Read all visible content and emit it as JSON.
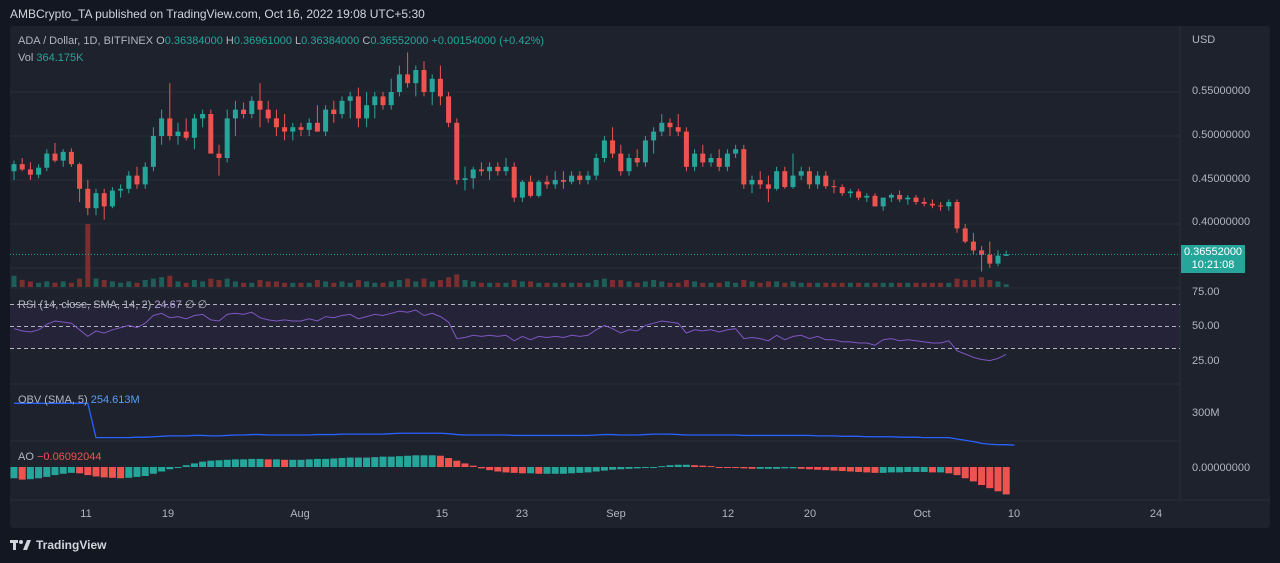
{
  "header": {
    "text": "AMBCrypto_TA published on TradingView.com, Oct 16, 2022 19:08 UTC+5:30"
  },
  "legend": {
    "symbol": "ADA / Dollar, 1D, BITFINEX",
    "o_label": "O",
    "o": "0.36384000",
    "h_label": "H",
    "h": "0.36961000",
    "l_label": "L",
    "l": "0.36384000",
    "c_label": "C",
    "c": "0.36552000",
    "change": "+0.00154000 (+0.42%)",
    "vol_label": "Vol",
    "vol": "364.175K"
  },
  "price_axis": {
    "currency": "USD",
    "ticks": [
      "0.55000000",
      "0.50000000",
      "0.45000000",
      "0.40000000"
    ],
    "last_price": "0.36552000",
    "countdown": "10:21:08"
  },
  "rsi": {
    "label": "RSI (14, close, SMA, 14, 2)",
    "value": "24.67",
    "extra": "∅ ∅",
    "ticks": [
      "75.00",
      "50.00",
      "25.00"
    ]
  },
  "obv": {
    "label": "OBV (SMA, 5)",
    "value": "254.613M",
    "tick": "300M"
  },
  "ao": {
    "label": "AO",
    "value": "−0.06092044",
    "tick": "0.00000000"
  },
  "time_axis": [
    "11",
    "19",
    "Aug",
    "15",
    "23",
    "Sep",
    "12",
    "20",
    "Oct",
    "10",
    "24"
  ],
  "brand": "TradingView",
  "colors": {
    "up": "#26a69a",
    "down": "#ef5350",
    "rsi": "#7e57c2",
    "obv": "#2962ff"
  },
  "chart_data": {
    "type": "candlestick",
    "symbol": "ADA/USD",
    "interval": "1D",
    "ohlc": [
      [
        0.46,
        0.472,
        0.45,
        0.468
      ],
      [
        0.468,
        0.475,
        0.46,
        0.462
      ],
      [
        0.462,
        0.47,
        0.45,
        0.456
      ],
      [
        0.456,
        0.468,
        0.452,
        0.464
      ],
      [
        0.464,
        0.485,
        0.46,
        0.48
      ],
      [
        0.48,
        0.492,
        0.47,
        0.472
      ],
      [
        0.472,
        0.485,
        0.465,
        0.482
      ],
      [
        0.482,
        0.486,
        0.465,
        0.468
      ],
      [
        0.468,
        0.47,
        0.425,
        0.44
      ],
      [
        0.44,
        0.45,
        0.41,
        0.418
      ],
      [
        0.418,
        0.44,
        0.41,
        0.435
      ],
      [
        0.435,
        0.44,
        0.405,
        0.42
      ],
      [
        0.42,
        0.442,
        0.418,
        0.438
      ],
      [
        0.438,
        0.445,
        0.43,
        0.44
      ],
      [
        0.44,
        0.46,
        0.435,
        0.455
      ],
      [
        0.455,
        0.465,
        0.44,
        0.445
      ],
      [
        0.445,
        0.47,
        0.44,
        0.465
      ],
      [
        0.465,
        0.51,
        0.46,
        0.5
      ],
      [
        0.5,
        0.53,
        0.49,
        0.52
      ],
      [
        0.52,
        0.56,
        0.495,
        0.5
      ],
      [
        0.5,
        0.515,
        0.49,
        0.505
      ],
      [
        0.505,
        0.52,
        0.495,
        0.498
      ],
      [
        0.498,
        0.525,
        0.485,
        0.52
      ],
      [
        0.52,
        0.53,
        0.51,
        0.525
      ],
      [
        0.525,
        0.53,
        0.48,
        0.48
      ],
      [
        0.48,
        0.49,
        0.455,
        0.475
      ],
      [
        0.475,
        0.53,
        0.47,
        0.52
      ],
      [
        0.52,
        0.54,
        0.5,
        0.53
      ],
      [
        0.53,
        0.538,
        0.52,
        0.525
      ],
      [
        0.525,
        0.545,
        0.52,
        0.54
      ],
      [
        0.54,
        0.56,
        0.51,
        0.53
      ],
      [
        0.53,
        0.54,
        0.515,
        0.52
      ],
      [
        0.52,
        0.53,
        0.5,
        0.51
      ],
      [
        0.51,
        0.525,
        0.495,
        0.505
      ],
      [
        0.505,
        0.515,
        0.495,
        0.51
      ],
      [
        0.51,
        0.515,
        0.5,
        0.507
      ],
      [
        0.507,
        0.52,
        0.5,
        0.515
      ],
      [
        0.515,
        0.535,
        0.505,
        0.505
      ],
      [
        0.505,
        0.535,
        0.5,
        0.53
      ],
      [
        0.53,
        0.54,
        0.515,
        0.525
      ],
      [
        0.525,
        0.545,
        0.52,
        0.54
      ],
      [
        0.54,
        0.55,
        0.52,
        0.545
      ],
      [
        0.545,
        0.555,
        0.51,
        0.52
      ],
      [
        0.52,
        0.55,
        0.51,
        0.535
      ],
      [
        0.535,
        0.55,
        0.52,
        0.545
      ],
      [
        0.545,
        0.55,
        0.53,
        0.535
      ],
      [
        0.535,
        0.565,
        0.53,
        0.55
      ],
      [
        0.55,
        0.58,
        0.545,
        0.57
      ],
      [
        0.57,
        0.595,
        0.555,
        0.56
      ],
      [
        0.56,
        0.58,
        0.545,
        0.575
      ],
      [
        0.575,
        0.585,
        0.545,
        0.55
      ],
      [
        0.55,
        0.57,
        0.535,
        0.565
      ],
      [
        0.565,
        0.58,
        0.535,
        0.545
      ],
      [
        0.545,
        0.55,
        0.51,
        0.515
      ],
      [
        0.515,
        0.52,
        0.445,
        0.45
      ],
      [
        0.45,
        0.465,
        0.438,
        0.452
      ],
      [
        0.452,
        0.465,
        0.44,
        0.462
      ],
      [
        0.462,
        0.47,
        0.455,
        0.46
      ],
      [
        0.46,
        0.47,
        0.45,
        0.465
      ],
      [
        0.465,
        0.47,
        0.455,
        0.46
      ],
      [
        0.46,
        0.475,
        0.455,
        0.465
      ],
      [
        0.465,
        0.47,
        0.425,
        0.43
      ],
      [
        0.43,
        0.45,
        0.425,
        0.448
      ],
      [
        0.448,
        0.455,
        0.43,
        0.432
      ],
      [
        0.432,
        0.45,
        0.43,
        0.448
      ],
      [
        0.448,
        0.455,
        0.44,
        0.445
      ],
      [
        0.445,
        0.46,
        0.44,
        0.45
      ],
      [
        0.45,
        0.46,
        0.44,
        0.448
      ],
      [
        0.448,
        0.46,
        0.445,
        0.455
      ],
      [
        0.455,
        0.46,
        0.445,
        0.45
      ],
      [
        0.45,
        0.46,
        0.445,
        0.455
      ],
      [
        0.455,
        0.48,
        0.45,
        0.475
      ],
      [
        0.475,
        0.5,
        0.47,
        0.495
      ],
      [
        0.495,
        0.51,
        0.475,
        0.48
      ],
      [
        0.48,
        0.49,
        0.455,
        0.46
      ],
      [
        0.46,
        0.48,
        0.455,
        0.475
      ],
      [
        0.475,
        0.485,
        0.465,
        0.47
      ],
      [
        0.47,
        0.5,
        0.465,
        0.495
      ],
      [
        0.495,
        0.51,
        0.48,
        0.505
      ],
      [
        0.505,
        0.525,
        0.5,
        0.515
      ],
      [
        0.515,
        0.52,
        0.5,
        0.51
      ],
      [
        0.51,
        0.525,
        0.5,
        0.505
      ],
      [
        0.505,
        0.51,
        0.46,
        0.465
      ],
      [
        0.465,
        0.485,
        0.46,
        0.48
      ],
      [
        0.48,
        0.49,
        0.465,
        0.47
      ],
      [
        0.47,
        0.48,
        0.465,
        0.475
      ],
      [
        0.475,
        0.485,
        0.46,
        0.465
      ],
      [
        0.465,
        0.485,
        0.46,
        0.48
      ],
      [
        0.48,
        0.49,
        0.475,
        0.485
      ],
      [
        0.485,
        0.49,
        0.44,
        0.445
      ],
      [
        0.445,
        0.455,
        0.435,
        0.45
      ],
      [
        0.45,
        0.46,
        0.44,
        0.445
      ],
      [
        0.445,
        0.455,
        0.425,
        0.44
      ],
      [
        0.44,
        0.465,
        0.438,
        0.46
      ],
      [
        0.46,
        0.465,
        0.44,
        0.442
      ],
      [
        0.442,
        0.48,
        0.44,
        0.455
      ],
      [
        0.455,
        0.465,
        0.45,
        0.46
      ],
      [
        0.46,
        0.465,
        0.44,
        0.445
      ],
      [
        0.445,
        0.46,
        0.44,
        0.455
      ],
      [
        0.455,
        0.46,
        0.44,
        0.443
      ],
      [
        0.443,
        0.45,
        0.435,
        0.442
      ],
      [
        0.442,
        0.445,
        0.432,
        0.435
      ],
      [
        0.435,
        0.44,
        0.43,
        0.437
      ],
      [
        0.437,
        0.44,
        0.427,
        0.43
      ],
      [
        0.43,
        0.435,
        0.425,
        0.432
      ],
      [
        0.432,
        0.435,
        0.42,
        0.42
      ],
      [
        0.42,
        0.43,
        0.415,
        0.43
      ],
      [
        0.43,
        0.435,
        0.425,
        0.433
      ],
      [
        0.433,
        0.438,
        0.425,
        0.428
      ],
      [
        0.428,
        0.433,
        0.422,
        0.43
      ],
      [
        0.43,
        0.433,
        0.422,
        0.425
      ],
      [
        0.425,
        0.43,
        0.42,
        0.423
      ],
      [
        0.423,
        0.428,
        0.418,
        0.421
      ],
      [
        0.421,
        0.425,
        0.415,
        0.42
      ],
      [
        0.42,
        0.428,
        0.415,
        0.425
      ],
      [
        0.425,
        0.428,
        0.39,
        0.395
      ],
      [
        0.395,
        0.4,
        0.378,
        0.38
      ],
      [
        0.38,
        0.39,
        0.365,
        0.37
      ],
      [
        0.37,
        0.375,
        0.346,
        0.365
      ],
      [
        0.365,
        0.38,
        0.35,
        0.355
      ],
      [
        0.355,
        0.37,
        0.352,
        0.364
      ],
      [
        0.3638,
        0.3696,
        0.3638,
        0.3655
      ]
    ],
    "volume": [
      0.8,
      0.5,
      0.4,
      0.3,
      0.4,
      0.3,
      0.4,
      0.3,
      0.6,
      4.5,
      0.6,
      0.5,
      0.4,
      0.3,
      0.4,
      0.3,
      0.5,
      0.6,
      0.7,
      0.8,
      0.4,
      0.3,
      0.5,
      0.4,
      0.6,
      0.5,
      0.6,
      0.4,
      0.3,
      0.3,
      0.5,
      0.4,
      0.4,
      0.3,
      0.3,
      0.3,
      0.3,
      0.5,
      0.4,
      0.3,
      0.4,
      0.3,
      0.5,
      0.4,
      0.3,
      0.3,
      0.4,
      0.5,
      0.6,
      0.4,
      0.6,
      0.4,
      0.5,
      0.7,
      0.9,
      0.5,
      0.4,
      0.3,
      0.3,
      0.3,
      0.3,
      0.5,
      0.4,
      0.4,
      0.3,
      0.3,
      0.3,
      0.3,
      0.3,
      0.3,
      0.3,
      0.5,
      0.6,
      0.5,
      0.5,
      0.4,
      0.3,
      0.4,
      0.5,
      0.4,
      0.3,
      0.3,
      0.5,
      0.4,
      0.3,
      0.3,
      0.3,
      0.4,
      0.3,
      0.5,
      0.4,
      0.3,
      0.4,
      0.4,
      0.3,
      0.4,
      0.3,
      0.3,
      0.3,
      0.3,
      0.3,
      0.3,
      0.3,
      0.3,
      0.3,
      0.3,
      0.3,
      0.3,
      0.3,
      0.3,
      0.3,
      0.3,
      0.3,
      0.3,
      0.3,
      0.6,
      0.5,
      0.5,
      0.7,
      0.5,
      0.4,
      0.2
    ],
    "rsi": [
      48,
      46,
      45,
      47,
      52,
      55,
      54,
      53,
      47,
      41,
      46,
      44,
      47,
      49,
      51,
      49,
      53,
      60,
      62,
      58,
      59,
      57,
      60,
      61,
      56,
      55,
      61,
      62,
      61,
      63,
      58,
      56,
      55,
      56,
      55,
      55,
      57,
      55,
      59,
      58,
      60,
      61,
      57,
      59,
      61,
      60,
      62,
      64,
      63,
      65,
      60,
      62,
      59,
      54,
      39,
      40,
      42,
      41,
      42,
      41,
      42,
      37,
      41,
      38,
      41,
      40,
      41,
      40,
      42,
      41,
      42,
      47,
      51,
      48,
      44,
      47,
      46,
      51,
      53,
      55,
      54,
      53,
      44,
      47,
      46,
      47,
      45,
      47,
      48,
      39,
      40,
      39,
      37,
      42,
      38,
      41,
      42,
      39,
      41,
      38,
      38,
      36,
      36,
      35,
      35,
      33,
      38,
      39,
      37,
      38,
      37,
      36,
      35,
      35,
      37,
      28,
      25,
      22,
      20,
      19,
      21,
      24.67
    ],
    "obv": [
      322,
      322,
      322,
      322,
      322,
      322,
      322,
      322,
      322,
      322,
      244,
      244,
      244,
      244,
      244,
      245,
      245,
      246,
      247,
      248,
      248,
      248,
      249,
      249,
      248,
      248,
      249,
      250,
      250,
      251,
      251,
      250,
      250,
      250,
      250,
      250,
      250,
      251,
      251,
      251,
      252,
      252,
      252,
      252,
      252,
      252,
      253,
      254,
      254,
      254,
      254,
      254,
      254,
      253,
      251,
      250,
      250,
      250,
      250,
      250,
      250,
      249,
      249,
      249,
      249,
      249,
      249,
      249,
      249,
      249,
      249,
      250,
      251,
      251,
      250,
      250,
      250,
      251,
      252,
      252,
      252,
      251,
      250,
      250,
      250,
      250,
      250,
      250,
      250,
      249,
      249,
      249,
      249,
      249,
      249,
      249,
      249,
      249,
      248,
      248,
      248,
      247,
      247,
      247,
      246,
      246,
      246,
      246,
      245,
      245,
      245,
      244,
      244,
      244,
      244,
      241,
      238,
      235,
      231,
      229,
      228,
      228,
      227
    ],
    "ao": [
      -0.025,
      -0.028,
      -0.027,
      -0.025,
      -0.022,
      -0.018,
      -0.015,
      -0.013,
      -0.014,
      -0.018,
      -0.021,
      -0.023,
      -0.024,
      -0.025,
      -0.024,
      -0.022,
      -0.02,
      -0.015,
      -0.01,
      -0.005,
      0.0,
      0.004,
      0.008,
      0.012,
      0.014,
      0.015,
      0.016,
      0.017,
      0.017,
      0.018,
      0.018,
      0.017,
      0.017,
      0.016,
      0.016,
      0.016,
      0.017,
      0.018,
      0.018,
      0.019,
      0.02,
      0.021,
      0.021,
      0.021,
      0.022,
      0.023,
      0.023,
      0.024,
      0.025,
      0.026,
      0.026,
      0.026,
      0.025,
      0.02,
      0.014,
      0.008,
      0.003,
      -0.003,
      -0.007,
      -0.01,
      -0.012,
      -0.013,
      -0.014,
      -0.014,
      -0.015,
      -0.015,
      -0.015,
      -0.015,
      -0.014,
      -0.013,
      -0.012,
      -0.01,
      -0.008,
      -0.006,
      -0.005,
      -0.004,
      -0.003,
      -0.002,
      0.0,
      0.002,
      0.004,
      0.005,
      0.005,
      0.004,
      0.003,
      0.002,
      0.0,
      -0.001,
      -0.002,
      -0.003,
      -0.004,
      -0.004,
      -0.004,
      -0.004,
      -0.003,
      -0.003,
      -0.004,
      -0.005,
      -0.006,
      -0.007,
      -0.008,
      -0.009,
      -0.01,
      -0.011,
      -0.012,
      -0.013,
      -0.013,
      -0.012,
      -0.012,
      -0.011,
      -0.011,
      -0.011,
      -0.012,
      -0.012,
      -0.014,
      -0.018,
      -0.025,
      -0.032,
      -0.04,
      -0.047,
      -0.054,
      -0.0609
    ]
  }
}
